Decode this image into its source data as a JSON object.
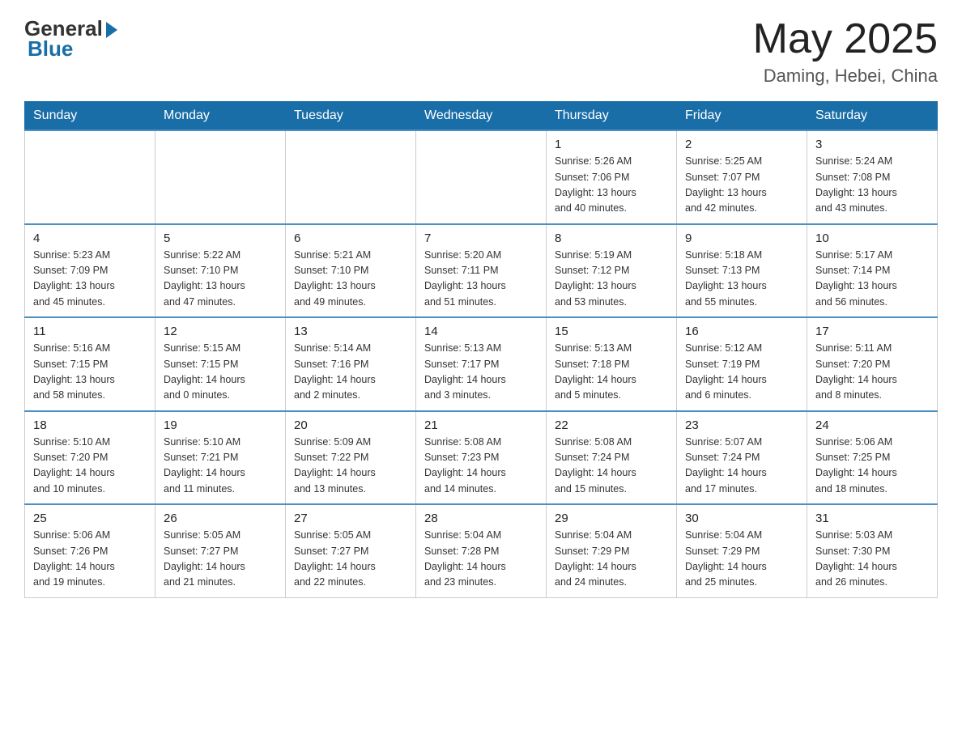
{
  "header": {
    "logo_general": "General",
    "logo_blue": "Blue",
    "month_year": "May 2025",
    "location": "Daming, Hebei, China"
  },
  "days_of_week": [
    "Sunday",
    "Monday",
    "Tuesday",
    "Wednesday",
    "Thursday",
    "Friday",
    "Saturday"
  ],
  "weeks": [
    [
      {
        "day": "",
        "info": ""
      },
      {
        "day": "",
        "info": ""
      },
      {
        "day": "",
        "info": ""
      },
      {
        "day": "",
        "info": ""
      },
      {
        "day": "1",
        "info": "Sunrise: 5:26 AM\nSunset: 7:06 PM\nDaylight: 13 hours\nand 40 minutes."
      },
      {
        "day": "2",
        "info": "Sunrise: 5:25 AM\nSunset: 7:07 PM\nDaylight: 13 hours\nand 42 minutes."
      },
      {
        "day": "3",
        "info": "Sunrise: 5:24 AM\nSunset: 7:08 PM\nDaylight: 13 hours\nand 43 minutes."
      }
    ],
    [
      {
        "day": "4",
        "info": "Sunrise: 5:23 AM\nSunset: 7:09 PM\nDaylight: 13 hours\nand 45 minutes."
      },
      {
        "day": "5",
        "info": "Sunrise: 5:22 AM\nSunset: 7:10 PM\nDaylight: 13 hours\nand 47 minutes."
      },
      {
        "day": "6",
        "info": "Sunrise: 5:21 AM\nSunset: 7:10 PM\nDaylight: 13 hours\nand 49 minutes."
      },
      {
        "day": "7",
        "info": "Sunrise: 5:20 AM\nSunset: 7:11 PM\nDaylight: 13 hours\nand 51 minutes."
      },
      {
        "day": "8",
        "info": "Sunrise: 5:19 AM\nSunset: 7:12 PM\nDaylight: 13 hours\nand 53 minutes."
      },
      {
        "day": "9",
        "info": "Sunrise: 5:18 AM\nSunset: 7:13 PM\nDaylight: 13 hours\nand 55 minutes."
      },
      {
        "day": "10",
        "info": "Sunrise: 5:17 AM\nSunset: 7:14 PM\nDaylight: 13 hours\nand 56 minutes."
      }
    ],
    [
      {
        "day": "11",
        "info": "Sunrise: 5:16 AM\nSunset: 7:15 PM\nDaylight: 13 hours\nand 58 minutes."
      },
      {
        "day": "12",
        "info": "Sunrise: 5:15 AM\nSunset: 7:15 PM\nDaylight: 14 hours\nand 0 minutes."
      },
      {
        "day": "13",
        "info": "Sunrise: 5:14 AM\nSunset: 7:16 PM\nDaylight: 14 hours\nand 2 minutes."
      },
      {
        "day": "14",
        "info": "Sunrise: 5:13 AM\nSunset: 7:17 PM\nDaylight: 14 hours\nand 3 minutes."
      },
      {
        "day": "15",
        "info": "Sunrise: 5:13 AM\nSunset: 7:18 PM\nDaylight: 14 hours\nand 5 minutes."
      },
      {
        "day": "16",
        "info": "Sunrise: 5:12 AM\nSunset: 7:19 PM\nDaylight: 14 hours\nand 6 minutes."
      },
      {
        "day": "17",
        "info": "Sunrise: 5:11 AM\nSunset: 7:20 PM\nDaylight: 14 hours\nand 8 minutes."
      }
    ],
    [
      {
        "day": "18",
        "info": "Sunrise: 5:10 AM\nSunset: 7:20 PM\nDaylight: 14 hours\nand 10 minutes."
      },
      {
        "day": "19",
        "info": "Sunrise: 5:10 AM\nSunset: 7:21 PM\nDaylight: 14 hours\nand 11 minutes."
      },
      {
        "day": "20",
        "info": "Sunrise: 5:09 AM\nSunset: 7:22 PM\nDaylight: 14 hours\nand 13 minutes."
      },
      {
        "day": "21",
        "info": "Sunrise: 5:08 AM\nSunset: 7:23 PM\nDaylight: 14 hours\nand 14 minutes."
      },
      {
        "day": "22",
        "info": "Sunrise: 5:08 AM\nSunset: 7:24 PM\nDaylight: 14 hours\nand 15 minutes."
      },
      {
        "day": "23",
        "info": "Sunrise: 5:07 AM\nSunset: 7:24 PM\nDaylight: 14 hours\nand 17 minutes."
      },
      {
        "day": "24",
        "info": "Sunrise: 5:06 AM\nSunset: 7:25 PM\nDaylight: 14 hours\nand 18 minutes."
      }
    ],
    [
      {
        "day": "25",
        "info": "Sunrise: 5:06 AM\nSunset: 7:26 PM\nDaylight: 14 hours\nand 19 minutes."
      },
      {
        "day": "26",
        "info": "Sunrise: 5:05 AM\nSunset: 7:27 PM\nDaylight: 14 hours\nand 21 minutes."
      },
      {
        "day": "27",
        "info": "Sunrise: 5:05 AM\nSunset: 7:27 PM\nDaylight: 14 hours\nand 22 minutes."
      },
      {
        "day": "28",
        "info": "Sunrise: 5:04 AM\nSunset: 7:28 PM\nDaylight: 14 hours\nand 23 minutes."
      },
      {
        "day": "29",
        "info": "Sunrise: 5:04 AM\nSunset: 7:29 PM\nDaylight: 14 hours\nand 24 minutes."
      },
      {
        "day": "30",
        "info": "Sunrise: 5:04 AM\nSunset: 7:29 PM\nDaylight: 14 hours\nand 25 minutes."
      },
      {
        "day": "31",
        "info": "Sunrise: 5:03 AM\nSunset: 7:30 PM\nDaylight: 14 hours\nand 26 minutes."
      }
    ]
  ]
}
